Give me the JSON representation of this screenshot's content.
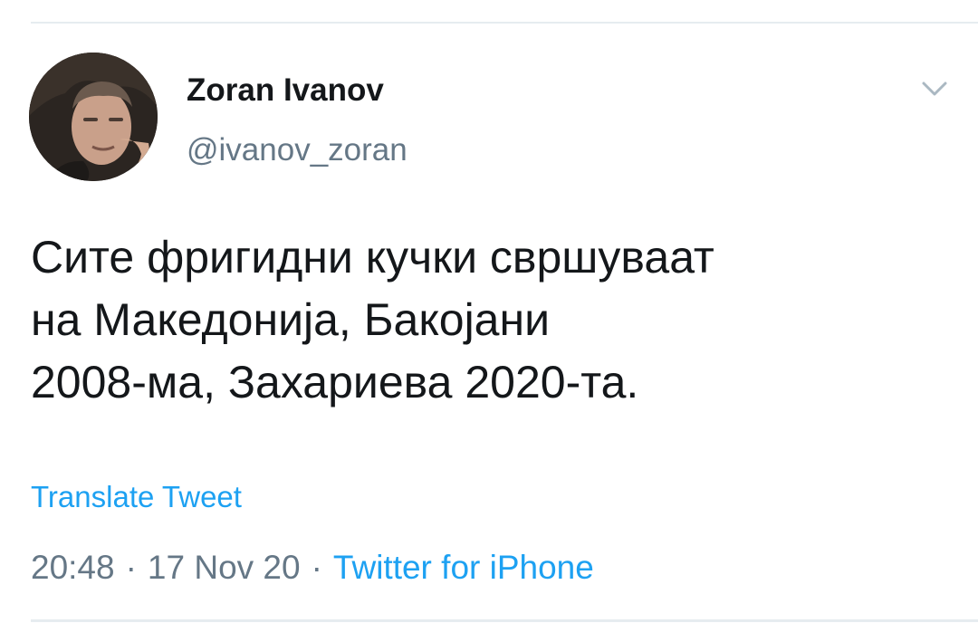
{
  "user": {
    "display_name": "Zoran Ivanov",
    "handle": "@ivanov_zoran",
    "avatar_icon": "profile-photo"
  },
  "menu": {
    "icon": "chevron-down-icon"
  },
  "tweet": {
    "text": "Сите фригидни кучки свршуваат\nна Македонија, Бакојани\n2008-ма, Захариева 2020-та.",
    "translate_label": "Translate Tweet",
    "time": "20:48",
    "date": "17 Nov 20",
    "separator": "·",
    "source": "Twitter for iPhone"
  },
  "colors": {
    "link": "#1da1f2",
    "secondary_text": "#657786",
    "primary_text": "#14171a",
    "divider": "#e6ecf0"
  }
}
